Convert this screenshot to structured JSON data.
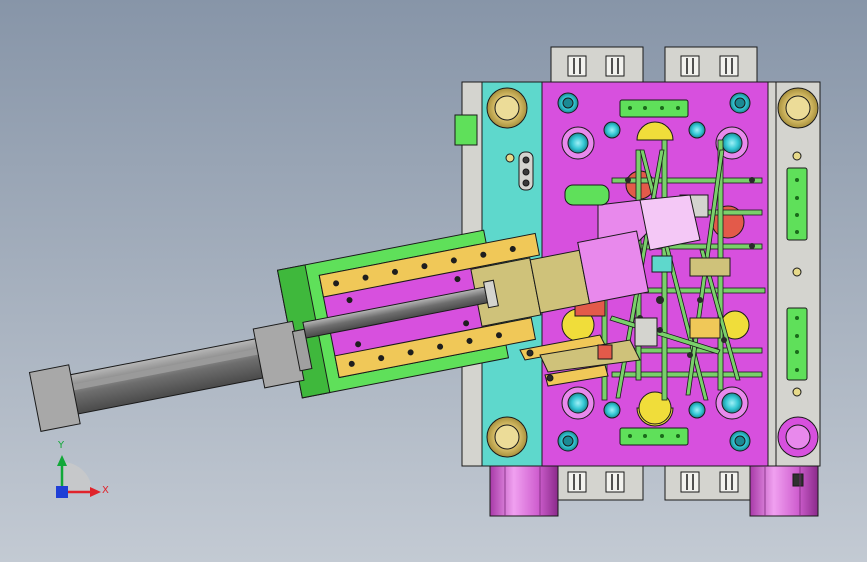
{
  "viewport": {
    "background_top": "#8795a8",
    "background_bottom": "#c3cad3",
    "display_style": "shaded-with-edges"
  },
  "colors": {
    "outline": "#1a1a1a",
    "plate_gray": "#d4d4cf",
    "plate_shadow": "#9a9a94",
    "cavity_plate": "#d750de",
    "core_plate": "#5ed8cc",
    "slider_green": "#5fe05a",
    "slider_dark_green": "#3fb83c",
    "wear_plate_yellow": "#f0c858",
    "cooling_line": "#7ad06b",
    "cylinder_gray": "#8c8c8c",
    "support_pillar": "#d670d6",
    "insert_red": "#e35a4a",
    "tan_block": "#cfc27a",
    "cyan_bushing": "#34c7d4"
  },
  "triad": {
    "x_label": "X",
    "y_label": "Y",
    "x_color": "#e0232b",
    "y_color": "#12a838",
    "z_color": "#1f3fd6"
  }
}
